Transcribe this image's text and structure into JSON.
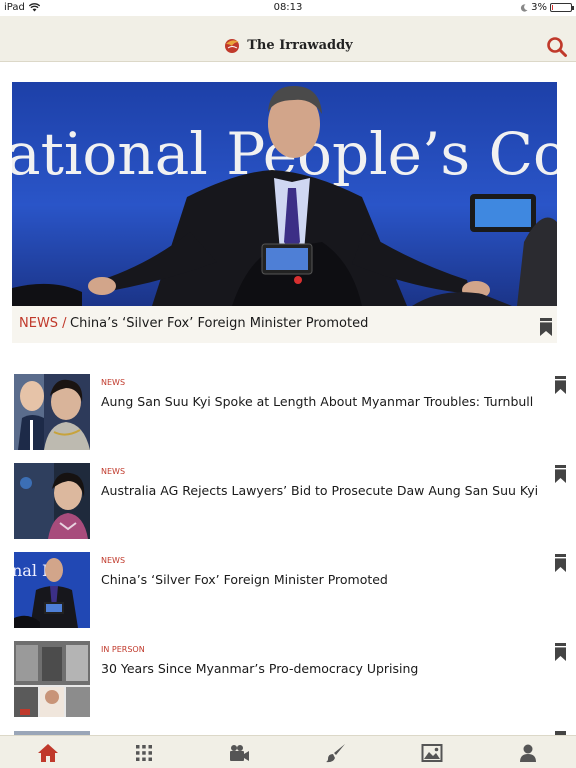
{
  "status_bar": {
    "device": "iPad",
    "time": "08:13",
    "battery": "3%",
    "battery_level": 0.03
  },
  "header": {
    "brand_prefix": "The ",
    "brand_name": "Irrawaddy",
    "brand_color": "#c0392b"
  },
  "hero": {
    "category": "NEWS /",
    "title": "China’s ‘Silver Fox’ Foreign Minister Promoted",
    "backdrop_text": "ational People’s Con"
  },
  "articles": [
    {
      "category": "NEWS",
      "title": "Aung San Suu Kyi Spoke at Length About Myanmar Troubles: Turnbull"
    },
    {
      "category": "NEWS",
      "title": "Australia AG Rejects Lawyers’ Bid to Prosecute Daw Aung San Suu Kyi"
    },
    {
      "category": "NEWS",
      "title": "China’s ‘Silver Fox’ Foreign Minister Promoted"
    },
    {
      "category": "IN PERSON",
      "title": "30 Years Since Myanmar’s Pro-democracy Uprising"
    }
  ],
  "thumb_texts": {
    "article_3": "nal Pe"
  },
  "tabs": [
    {
      "icon": "home-icon",
      "active": true
    },
    {
      "icon": "grid-icon",
      "active": false
    },
    {
      "icon": "video-camera-icon",
      "active": false
    },
    {
      "icon": "brush-icon",
      "active": false
    },
    {
      "icon": "photo-icon",
      "active": false
    },
    {
      "icon": "profile-icon",
      "active": false
    }
  ],
  "colors": {
    "accent": "#c0392b",
    "header_bg": "#f1efe6",
    "icon_gray": "#555555"
  }
}
